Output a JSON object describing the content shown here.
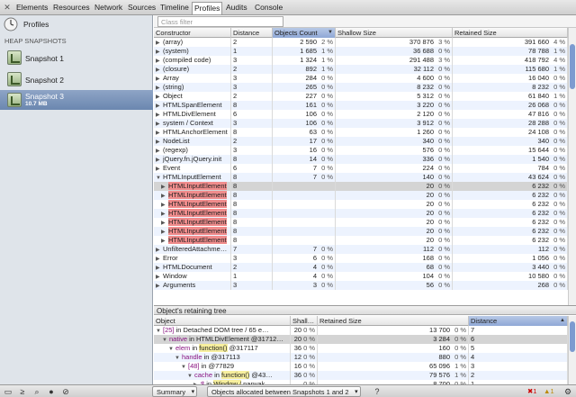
{
  "tabs": [
    "Elements",
    "Resources",
    "Network",
    "Sources",
    "Timeline",
    "Profiles",
    "Audits",
    "Console"
  ],
  "active_tab": "Profiles",
  "sidebar": {
    "title": "Profiles",
    "section": "HEAP SNAPSHOTS",
    "snapshots": [
      {
        "label": "Snapshot 1",
        "sub": ""
      },
      {
        "label": "Snapshot 2",
        "sub": ""
      },
      {
        "label": "Snapshot 3",
        "sub": "10.7 MB"
      }
    ]
  },
  "filter": {
    "placeholder": "Class filter",
    "value": ""
  },
  "grid": {
    "columns": [
      "Constructor",
      "Distance",
      "Objects Count",
      "Shallow Size",
      "Retained Size"
    ],
    "rows": [
      {
        "name": "(array)",
        "distance": "2",
        "count": "2 590",
        "count_pct": "2 %",
        "shallow": "370 876",
        "shallow_pct": "3 %",
        "retained": "391 660",
        "retained_pct": "4 %"
      },
      {
        "name": "(system)",
        "distance": "1",
        "count": "1 685",
        "count_pct": "1 %",
        "shallow": "36 688",
        "shallow_pct": "0 %",
        "retained": "78 788",
        "retained_pct": "1 %"
      },
      {
        "name": "(compiled code)",
        "distance": "3",
        "count": "1 324",
        "count_pct": "1 %",
        "shallow": "291 488",
        "shallow_pct": "3 %",
        "retained": "418 792",
        "retained_pct": "4 %"
      },
      {
        "name": "(closure)",
        "distance": "2",
        "count": "892",
        "count_pct": "1 %",
        "shallow": "32 112",
        "shallow_pct": "0 %",
        "retained": "115 680",
        "retained_pct": "1 %"
      },
      {
        "name": "Array",
        "distance": "3",
        "count": "284",
        "count_pct": "0 %",
        "shallow": "4 600",
        "shallow_pct": "0 %",
        "retained": "16 040",
        "retained_pct": "0 %"
      },
      {
        "name": "(string)",
        "distance": "3",
        "count": "265",
        "count_pct": "0 %",
        "shallow": "8 232",
        "shallow_pct": "0 %",
        "retained": "8 232",
        "retained_pct": "0 %"
      },
      {
        "name": "Object",
        "distance": "2",
        "count": "227",
        "count_pct": "0 %",
        "shallow": "5 312",
        "shallow_pct": "0 %",
        "retained": "61 840",
        "retained_pct": "1 %"
      },
      {
        "name": "HTMLSpanElement",
        "distance": "8",
        "count": "161",
        "count_pct": "0 %",
        "shallow": "3 220",
        "shallow_pct": "0 %",
        "retained": "26 068",
        "retained_pct": "0 %"
      },
      {
        "name": "HTMLDivElement",
        "distance": "6",
        "count": "106",
        "count_pct": "0 %",
        "shallow": "2 120",
        "shallow_pct": "0 %",
        "retained": "47 816",
        "retained_pct": "0 %"
      },
      {
        "name": "system / Context",
        "distance": "3",
        "count": "106",
        "count_pct": "0 %",
        "shallow": "3 912",
        "shallow_pct": "0 %",
        "retained": "28 288",
        "retained_pct": "0 %"
      },
      {
        "name": "HTMLAnchorElement",
        "distance": "8",
        "count": "63",
        "count_pct": "0 %",
        "shallow": "1 260",
        "shallow_pct": "0 %",
        "retained": "24 108",
        "retained_pct": "0 %"
      },
      {
        "name": "NodeList",
        "distance": "2",
        "count": "17",
        "count_pct": "0 %",
        "shallow": "340",
        "shallow_pct": "0 %",
        "retained": "340",
        "retained_pct": "0 %"
      },
      {
        "name": "(regexp)",
        "distance": "3",
        "count": "16",
        "count_pct": "0 %",
        "shallow": "576",
        "shallow_pct": "0 %",
        "retained": "15 644",
        "retained_pct": "0 %"
      },
      {
        "name": "jQuery.fn.jQuery.init",
        "distance": "8",
        "count": "14",
        "count_pct": "0 %",
        "shallow": "336",
        "shallow_pct": "0 %",
        "retained": "1 540",
        "retained_pct": "0 %"
      },
      {
        "name": "Event",
        "distance": "6",
        "count": "7",
        "count_pct": "0 %",
        "shallow": "224",
        "shallow_pct": "0 %",
        "retained": "784",
        "retained_pct": "0 %"
      },
      {
        "name": "HTMLInputElement",
        "distance": "8",
        "count": "7",
        "count_pct": "0 %",
        "shallow": "140",
        "shallow_pct": "0 %",
        "retained": "43 624",
        "retained_pct": "0 %",
        "expanded": true
      },
      {
        "name": "HTMLInputElement",
        "distance": "8",
        "count": "",
        "count_pct": "",
        "shallow": "20",
        "shallow_pct": "0 %",
        "retained": "6 232",
        "retained_pct": "0 %",
        "child": true,
        "selected": true
      },
      {
        "name": "HTMLInputElement",
        "distance": "8",
        "count": "",
        "count_pct": "",
        "shallow": "20",
        "shallow_pct": "0 %",
        "retained": "6 232",
        "retained_pct": "0 %",
        "child": true
      },
      {
        "name": "HTMLInputElement",
        "distance": "8",
        "count": "",
        "count_pct": "",
        "shallow": "20",
        "shallow_pct": "0 %",
        "retained": "6 232",
        "retained_pct": "0 %",
        "child": true
      },
      {
        "name": "HTMLInputElement",
        "distance": "8",
        "count": "",
        "count_pct": "",
        "shallow": "20",
        "shallow_pct": "0 %",
        "retained": "6 232",
        "retained_pct": "0 %",
        "child": true
      },
      {
        "name": "HTMLInputElement",
        "distance": "8",
        "count": "",
        "count_pct": "",
        "shallow": "20",
        "shallow_pct": "0 %",
        "retained": "6 232",
        "retained_pct": "0 %",
        "child": true
      },
      {
        "name": "HTMLInputElement",
        "distance": "8",
        "count": "",
        "count_pct": "",
        "shallow": "20",
        "shallow_pct": "0 %",
        "retained": "6 232",
        "retained_pct": "0 %",
        "child": true
      },
      {
        "name": "HTMLInputElement",
        "distance": "8",
        "count": "",
        "count_pct": "",
        "shallow": "20",
        "shallow_pct": "0 %",
        "retained": "6 232",
        "retained_pct": "0 %",
        "child": true
      },
      {
        "name": "UnfilteredAttachme…",
        "distance": "7",
        "count": "7",
        "count_pct": "0 %",
        "shallow": "112",
        "shallow_pct": "0 %",
        "retained": "112",
        "retained_pct": "0 %"
      },
      {
        "name": "Error",
        "distance": "3",
        "count": "6",
        "count_pct": "0 %",
        "shallow": "168",
        "shallow_pct": "0 %",
        "retained": "1 056",
        "retained_pct": "0 %"
      },
      {
        "name": "HTMLDocument",
        "distance": "2",
        "count": "4",
        "count_pct": "0 %",
        "shallow": "68",
        "shallow_pct": "0 %",
        "retained": "3 440",
        "retained_pct": "0 %"
      },
      {
        "name": "Window",
        "distance": "1",
        "count": "4",
        "count_pct": "0 %",
        "shallow": "104",
        "shallow_pct": "0 %",
        "retained": "10 580",
        "retained_pct": "0 %"
      },
      {
        "name": "Arguments",
        "distance": "3",
        "count": "3",
        "count_pct": "0 %",
        "shallow": "56",
        "shallow_pct": "0 %",
        "retained": "268",
        "retained_pct": "0 %"
      }
    ]
  },
  "retainers": {
    "title": "Object's retaining tree",
    "columns": [
      "Object",
      "Shall…",
      "Retained Size",
      "Distance"
    ],
    "rows": [
      {
        "indent": 0,
        "prop": "[25]",
        "rest": " in Detached DOM tree / 65 e…",
        "fn": "",
        "shallow": "20",
        "shallow_pct": "0 %",
        "retained": "13 700",
        "retained_pct": "0 %",
        "distance": "7"
      },
      {
        "indent": 1,
        "prop": "native",
        "rest": " in HTMLDivElement @31712…",
        "fn": "",
        "shallow": "20",
        "shallow_pct": "0 %",
        "retained": "3 284",
        "retained_pct": "0 %",
        "distance": "6",
        "selected": true
      },
      {
        "indent": 2,
        "prop": "elem",
        "rest": " @317117",
        "fn": "function()",
        "shallow": "36",
        "shallow_pct": "0 %",
        "retained": "160",
        "retained_pct": "0 %",
        "distance": "5"
      },
      {
        "indent": 3,
        "prop": "handle",
        "rest": " in @317113",
        "fn": "",
        "shallow": "12",
        "shallow_pct": "0 %",
        "retained": "880",
        "retained_pct": "0 %",
        "distance": "4"
      },
      {
        "indent": 4,
        "prop": "[48]",
        "rest": " in @77829",
        "fn": "",
        "shallow": "16",
        "shallow_pct": "0 %",
        "retained": "65 096",
        "retained_pct": "1 %",
        "distance": "3"
      },
      {
        "indent": 5,
        "prop": "cache",
        "rest": " @43…",
        "fn": "function()",
        "shallow": "36",
        "shallow_pct": "0 %",
        "retained": "79 576",
        "retained_pct": "1 %",
        "distance": "2"
      },
      {
        "indent": 6,
        "prop": "$",
        "rest": " panyak…",
        "fn": "Window /",
        "shallow": "",
        "shallow_pct": "0 %",
        "retained": "8 700",
        "retained_pct": "0 %",
        "distance": "1"
      },
      {
        "indent": 6,
        "prop": "jQuery",
        "rest": " p…",
        "fn": "Window /",
        "shallow": "",
        "shallow_pct": "0 %",
        "retained": "8 700",
        "retained_pct": "0 %",
        "distance": "1"
      }
    ]
  },
  "statusbar": {
    "view": "Summary",
    "filter": "Objects allocated between Snapshots 1 and 2",
    "help": "?",
    "errors": "1",
    "warnings": "1"
  }
}
